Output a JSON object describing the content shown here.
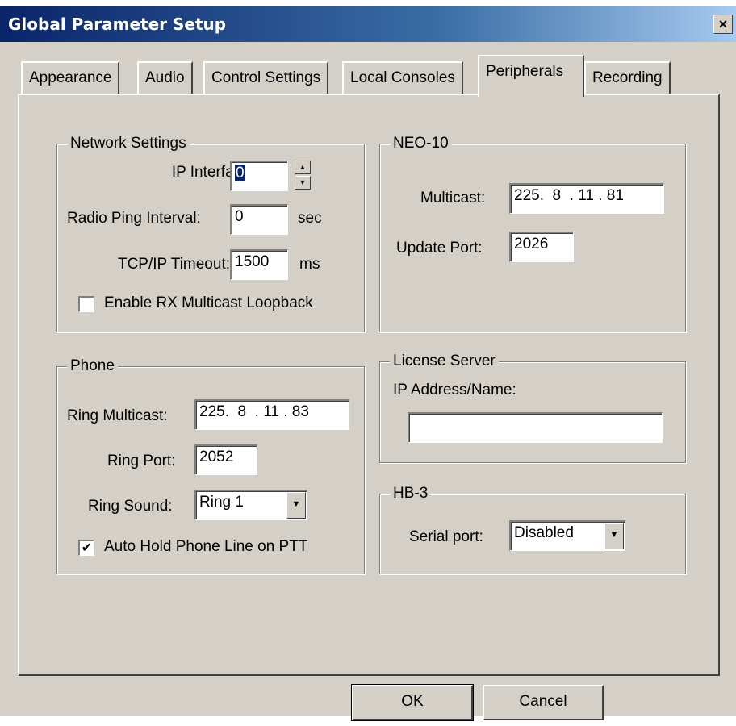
{
  "window": {
    "title": "Global Parameter Setup",
    "close_glyph": "×"
  },
  "tabs": [
    {
      "label": "Appearance"
    },
    {
      "label": "Audio"
    },
    {
      "label": "Control Settings"
    },
    {
      "label": "Local Consoles"
    },
    {
      "label": "Peripherals",
      "active": true
    },
    {
      "label": "Recording"
    }
  ],
  "network": {
    "legend": "Network Settings",
    "ip_interface_label": "IP Interface:",
    "ip_interface_value": "0",
    "radio_ping_label": "Radio Ping Interval:",
    "radio_ping_value": "0",
    "radio_ping_unit": "sec",
    "tcp_timeout_label": "TCP/IP Timeout:",
    "tcp_timeout_value": "1500",
    "tcp_timeout_unit": "ms",
    "multicast_loopback_label": "Enable RX Multicast Loopback",
    "multicast_loopback_checked": false
  },
  "neo10": {
    "legend": "NEO-10",
    "multicast_label": "Multicast:",
    "multicast_value": "225.  8  . 11 . 81",
    "update_port_label": "Update Port:",
    "update_port_value": "2026"
  },
  "phone": {
    "legend": "Phone",
    "ring_multicast_label": "Ring Multicast:",
    "ring_multicast_value": "225.  8  . 11 . 83",
    "ring_port_label": "Ring Port:",
    "ring_port_value": "2052",
    "ring_sound_label": "Ring Sound:",
    "ring_sound_value": "Ring 1",
    "auto_hold_label": "Auto Hold Phone Line on PTT",
    "auto_hold_checked": true,
    "check_glyph": "✔"
  },
  "license": {
    "legend": "License Server",
    "ip_label": "IP Address/Name:",
    "ip_value": ""
  },
  "hb3": {
    "legend": "HB-3",
    "serial_port_label": "Serial port:",
    "serial_port_value": "Disabled"
  },
  "buttons": {
    "ok": "OK",
    "cancel": "Cancel"
  },
  "glyphs": {
    "up": "▲",
    "down": "▼"
  }
}
